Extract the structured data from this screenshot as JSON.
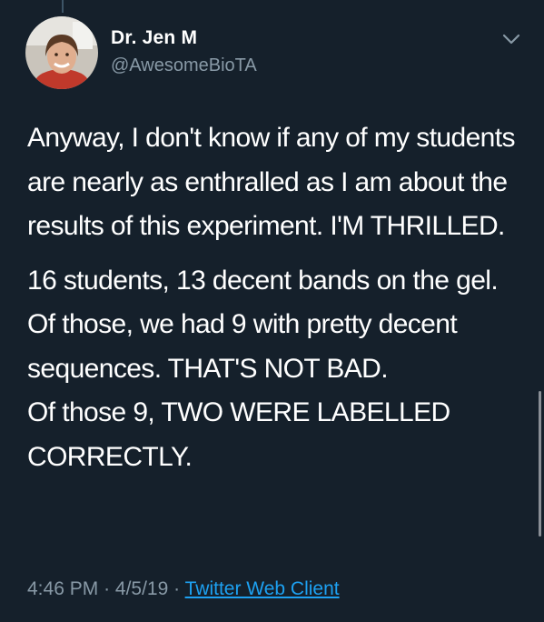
{
  "tweet": {
    "author": {
      "name": "Dr. Jen M",
      "handle": "@AwesomeBioTA",
      "avatar_icon": "profile-photo"
    },
    "menu_icon": "chevron-down-icon",
    "paragraphs": [
      "Anyway, I don't know if any of my students are nearly as enthralled as I am about the results of this experiment. I'M THRILLED."
    ],
    "lines": [
      "16 students, 13 decent bands on the gel.",
      "Of those, we had 9 with pretty decent sequences. THAT'S NOT BAD.",
      "Of those 9, TWO WERE LABELLED CORRECTLY."
    ],
    "time": "4:46 PM",
    "separator": "·",
    "date": "4/5/19",
    "client": "Twitter Web Client"
  },
  "colors": {
    "background": "#15202b",
    "text": "#ffffff",
    "secondary": "#8899a6",
    "link": "#1da1f2"
  }
}
